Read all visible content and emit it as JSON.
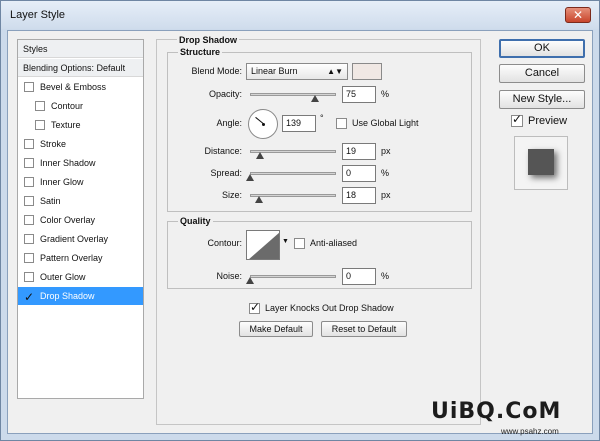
{
  "window": {
    "title": "Layer Style",
    "close_glyph": "✕"
  },
  "left_list": {
    "header": "Styles",
    "blending": "Blending Options: Default",
    "items": [
      {
        "label": "Bevel & Emboss",
        "checked": false,
        "indent": 0
      },
      {
        "label": "Contour",
        "checked": false,
        "indent": 1
      },
      {
        "label": "Texture",
        "checked": false,
        "indent": 1
      },
      {
        "label": "Stroke",
        "checked": false,
        "indent": 0
      },
      {
        "label": "Inner Shadow",
        "checked": false,
        "indent": 0
      },
      {
        "label": "Inner Glow",
        "checked": false,
        "indent": 0
      },
      {
        "label": "Satin",
        "checked": false,
        "indent": 0
      },
      {
        "label": "Color Overlay",
        "checked": false,
        "indent": 0
      },
      {
        "label": "Gradient Overlay",
        "checked": false,
        "indent": 0
      },
      {
        "label": "Pattern Overlay",
        "checked": false,
        "indent": 0
      },
      {
        "label": "Outer Glow",
        "checked": false,
        "indent": 0
      },
      {
        "label": "Drop Shadow",
        "checked": true,
        "indent": 0,
        "selected": true
      }
    ]
  },
  "drop_shadow": {
    "title": "Drop Shadow",
    "structure": {
      "title": "Structure",
      "blend_mode_label": "Blend Mode:",
      "blend_mode_value": "Linear Burn",
      "blend_color": "#f0e8e4",
      "opacity_label": "Opacity:",
      "opacity_value": "75",
      "opacity_fraction": 0.75,
      "percent": "%",
      "angle_label": "Angle:",
      "angle_value": "139",
      "degree": "°",
      "global_light_label": "Use Global Light",
      "global_light_checked": false,
      "distance_label": "Distance:",
      "distance_value": "19",
      "distance_fraction": 0.12,
      "px": "px",
      "spread_label": "Spread:",
      "spread_value": "0",
      "spread_fraction": 0,
      "size_label": "Size:",
      "size_value": "18",
      "size_fraction": 0.1
    },
    "quality": {
      "title": "Quality",
      "contour_label": "Contour:",
      "anti_aliased_label": "Anti-aliased",
      "anti_aliased_checked": false,
      "noise_label": "Noise:",
      "noise_value": "0",
      "noise_fraction": 0
    },
    "knockout_label": "Layer Knocks Out Drop Shadow",
    "knockout_checked": true,
    "make_default": "Make Default",
    "reset_default": "Reset to Default"
  },
  "buttons": {
    "ok": "OK",
    "cancel": "Cancel",
    "new_style": "New Style...",
    "preview": "Preview",
    "preview_checked": true
  },
  "watermark": {
    "main": "UiBQ.CoM",
    "sub": "www.psahz.com"
  },
  "colors": {
    "selection": "#3399ff",
    "title_bar": "#ccdaeb"
  },
  "icons": {
    "close": "close-icon",
    "dropdown": "chevron-down-icon",
    "check": "check-icon"
  }
}
